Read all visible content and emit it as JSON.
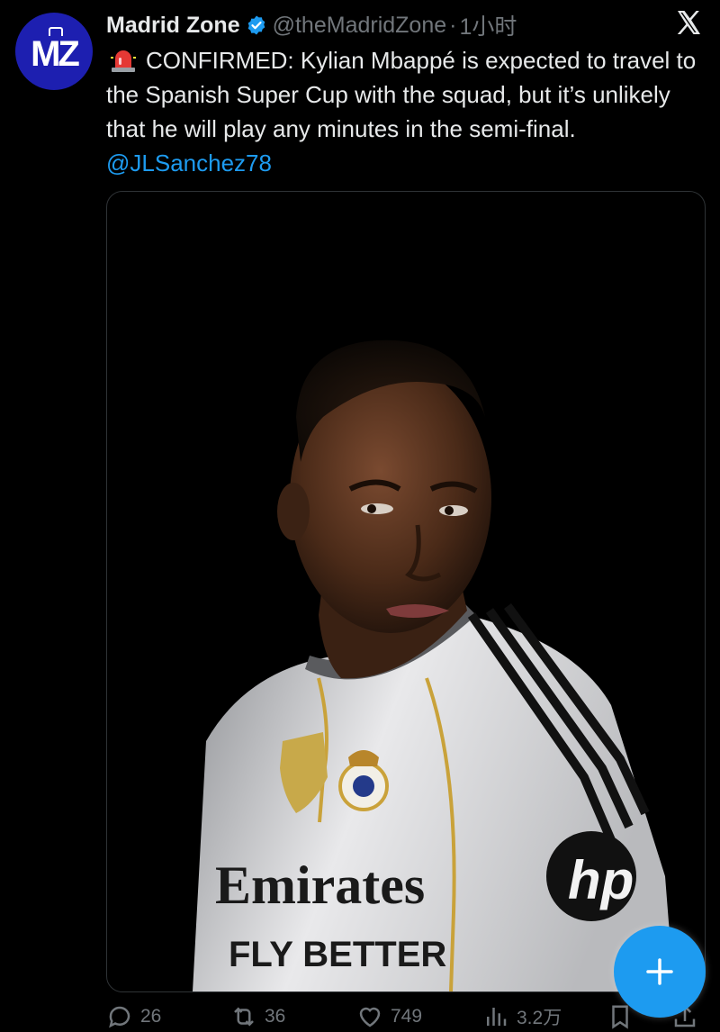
{
  "account": {
    "avatar_text": "MZ",
    "display_name": "Madrid Zone",
    "handle": "@theMadridZone",
    "separator": "·",
    "time": "1小时"
  },
  "tweet": {
    "text_main": "CONFIRMED: Kylian Mbappé is expected to travel to the Spanish Super Cup with the squad, but it’s unlikely that he will play any minutes in the semi-final.",
    "mention": "@JLSanchez78"
  },
  "photo": {
    "shirt_sponsor_line1": "Emirates",
    "shirt_sponsor_line2": "FLY BETTER",
    "sleeve_logo": "hp"
  },
  "actions": {
    "replies": "26",
    "reposts": "36",
    "likes": "749",
    "views": "3.2万"
  },
  "colors": {
    "background": "#000000",
    "text": "#e7e9ea",
    "muted": "#71767b",
    "accent": "#1d9bf0",
    "avatar_bg": "#1d1fb0"
  },
  "icons": {
    "verified": "verified-badge-icon",
    "close": "x-logo-icon",
    "siren": "siren-emoji-icon",
    "reply": "reply-icon",
    "repost": "repost-icon",
    "like": "heart-icon",
    "views": "views-chart-icon",
    "bookmark": "bookmark-icon",
    "share": "share-icon",
    "compose": "plus-icon"
  }
}
